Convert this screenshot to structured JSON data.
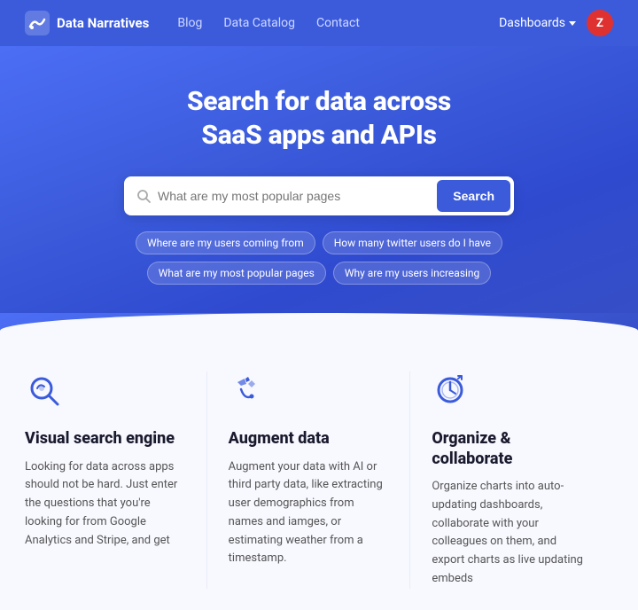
{
  "nav": {
    "logo_text": "Data Narratives",
    "links": [
      "Blog",
      "Data Catalog",
      "Contact"
    ],
    "dashboards_label": "Dashboards",
    "avatar_letter": "Z"
  },
  "hero": {
    "title_line1": "Search for data across",
    "title_line2": "SaaS apps and APIs",
    "search_placeholder": "What are my most popular pages",
    "search_button_label": "Search",
    "pills": [
      "Where are my users coming from",
      "How many twitter users do I have",
      "What are my most popular pages",
      "Why are my users increasing"
    ]
  },
  "features": [
    {
      "icon": "🔍",
      "title": "Visual search engine",
      "desc": "Looking for data across apps should not be hard. Just enter the questions that you're looking for from Google Analytics and Stripe, and get"
    },
    {
      "icon": "✨",
      "title": "Augment data",
      "desc": "Augment your data with AI or third party data, like extracting user demographics from names and iamges, or estimating weather from a timestamp."
    },
    {
      "icon": "⏱",
      "title": "Organize & collaborate",
      "desc": "Organize charts into auto-updating dashboards, collaborate with your colleagues on them, and export charts as live updating embeds"
    }
  ]
}
